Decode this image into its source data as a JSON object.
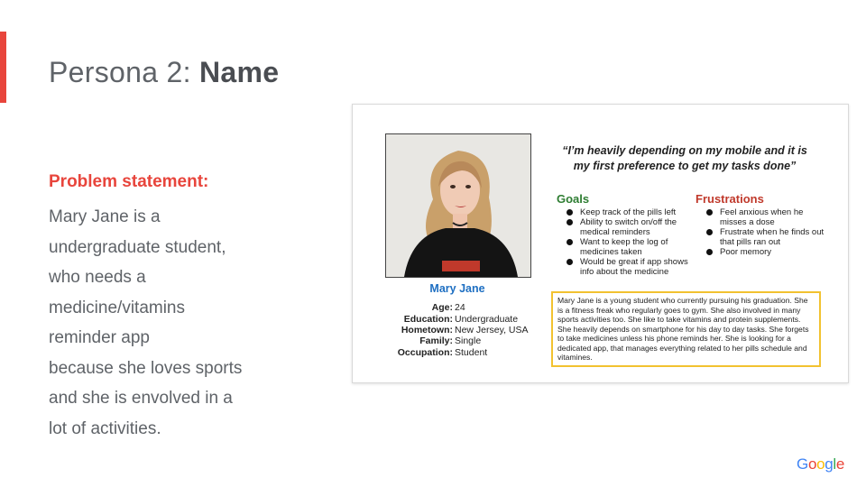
{
  "colors": {
    "accent": "#e8453c",
    "goals_green": "#2e7d32",
    "frustrations_red": "#c0392b",
    "name_blue": "#1e6fc2",
    "bio_border": "#f2c230"
  },
  "slide": {
    "title_prefix": "Persona 2: ",
    "title_bold": "Name",
    "problem_label": "Problem statement:",
    "problem_lines": [
      "Mary Jane is a",
      "undergraduate student,",
      "who needs a",
      "medicine/vitamins",
      "reminder app",
      "because she loves sports",
      "and she is envolved in a",
      "lot of activities."
    ]
  },
  "persona": {
    "name": "Mary Jane",
    "details": [
      {
        "label": "Age:",
        "value": "24"
      },
      {
        "label": "Education:",
        "value": "Undergraduate"
      },
      {
        "label": "Hometown:",
        "value": "New Jersey, USA"
      },
      {
        "label": "Family:",
        "value": "Single"
      },
      {
        "label": "Occupation:",
        "value": "Student"
      }
    ],
    "quote_line1": "“I’m heavily depending on my mobile and it is",
    "quote_line2": "my first preference to get my tasks done”",
    "goals_title": "Goals",
    "goals": [
      "Keep track of the pills left",
      "Ability to switch on/off the medical reminders",
      "Want to keep the log of medicines taken",
      "Would be great if app shows info about the medicine"
    ],
    "frustrations_title": "Frustrations",
    "frustrations": [
      "Feel anxious when he misses a dose",
      "Frustrate when he finds out that pills ran out",
      "Poor memory"
    ],
    "bio": "Mary Jane is a young student who currently pursuing his graduation. She is a fitness freak who regularly goes to gym. She also involved in many sports activities too. She like to take vitamins and protein supplements. She heavily depends on smartphone for his day to day tasks. She forgets to take medicines unless his phone reminds her. She is looking for a dedicated app, that manages everything related to her pills schedule and vitamines."
  },
  "logo": {
    "letters": [
      {
        "ch": "G",
        "color": "#4285f4"
      },
      {
        "ch": "o",
        "color": "#ea4335"
      },
      {
        "ch": "o",
        "color": "#fbbc05"
      },
      {
        "ch": "g",
        "color": "#4285f4"
      },
      {
        "ch": "l",
        "color": "#34a853"
      },
      {
        "ch": "e",
        "color": "#ea4335"
      }
    ]
  }
}
